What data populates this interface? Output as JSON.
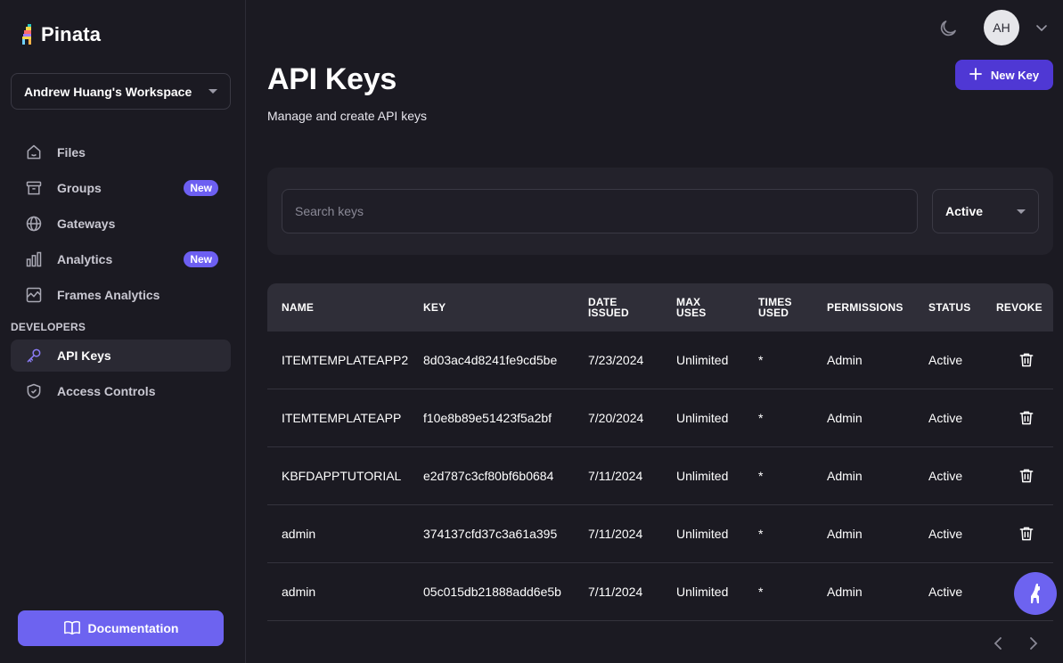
{
  "app": {
    "name": "Pinata"
  },
  "workspace": {
    "name": "Andrew Huang's Workspace"
  },
  "sidebar": {
    "items": [
      {
        "label": "Files",
        "icon": "home-icon"
      },
      {
        "label": "Groups",
        "icon": "archive-icon",
        "badge": "New"
      },
      {
        "label": "Gateways",
        "icon": "globe-icon"
      },
      {
        "label": "Analytics",
        "icon": "bar-chart-icon",
        "badge": "New"
      },
      {
        "label": "Frames Analytics",
        "icon": "line-chart-icon"
      }
    ],
    "section_label": "DEVELOPERS",
    "dev_items": [
      {
        "label": "API Keys",
        "icon": "key-icon",
        "active": true
      },
      {
        "label": "Access Controls",
        "icon": "shield-icon"
      }
    ],
    "documentation_label": "Documentation"
  },
  "topbar": {
    "avatar_initials": "AH"
  },
  "header": {
    "title": "API Keys",
    "subtitle": "Manage and create API keys",
    "new_key_label": "New Key"
  },
  "filters": {
    "search_placeholder": "Search keys",
    "status_value": "Active"
  },
  "table": {
    "columns": {
      "name": "NAME",
      "key": "KEY",
      "date_issued": [
        "DATE",
        "ISSUED"
      ],
      "max_uses": [
        "MAX",
        "USES"
      ],
      "times_used": [
        "TIMES",
        "USED"
      ],
      "permissions": "PERMISSIONS",
      "status": "STATUS",
      "revoke": "REVOKE"
    },
    "rows": [
      {
        "name": "ITEMTEMPLATEAPP2",
        "key": "8d03ac4d8241fe9cd5be",
        "date": "7/23/2024",
        "max_uses": "Unlimited",
        "times_used": "*",
        "permissions": "Admin",
        "status": "Active"
      },
      {
        "name": "ITEMTEMPLATEAPP",
        "key": "f10e8b89e51423f5a2bf",
        "date": "7/20/2024",
        "max_uses": "Unlimited",
        "times_used": "*",
        "permissions": "Admin",
        "status": "Active"
      },
      {
        "name": "KBFDAPPTUTORIAL",
        "key": "e2d787c3cf80bf6b0684",
        "date": "7/11/2024",
        "max_uses": "Unlimited",
        "times_used": "*",
        "permissions": "Admin",
        "status": "Active"
      },
      {
        "name": "admin",
        "key": "374137cfd37c3a61a395",
        "date": "7/11/2024",
        "max_uses": "Unlimited",
        "times_used": "*",
        "permissions": "Admin",
        "status": "Active"
      },
      {
        "name": "admin",
        "key": "05c015db21888add6e5b",
        "date": "7/11/2024",
        "max_uses": "Unlimited",
        "times_used": "*",
        "permissions": "Admin",
        "status": "Active"
      }
    ]
  },
  "colors": {
    "background": "#1b1a22",
    "accent": "#6d63f0",
    "primary_button": "#4f38d4",
    "badge": "#6d5ff2"
  }
}
